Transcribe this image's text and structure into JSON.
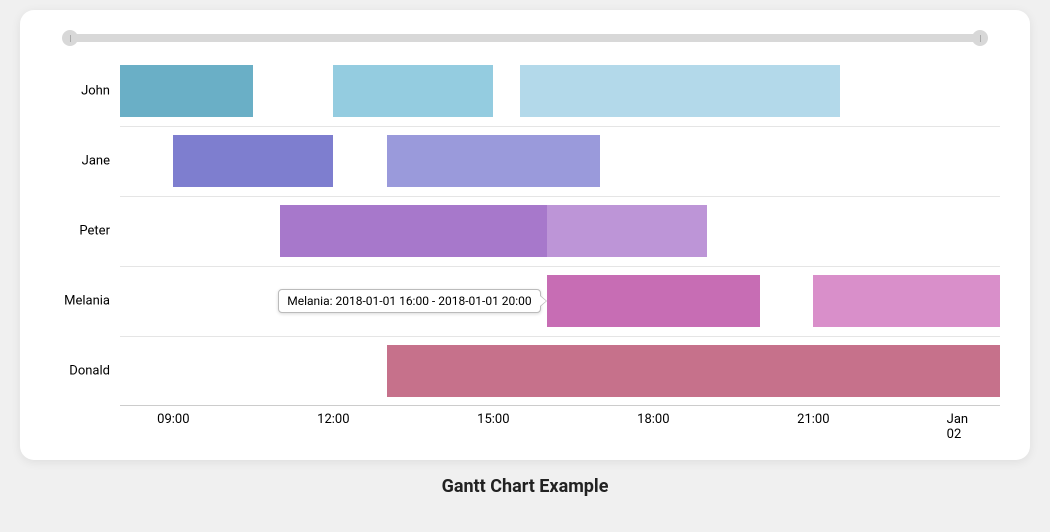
{
  "caption": "Gantt Chart Example",
  "chart_data": {
    "type": "bar",
    "orientation": "gantt",
    "x_axis": {
      "min": "2018-01-01 08:00",
      "max": "2018-01-02 00:30",
      "ticks": [
        "09:00",
        "12:00",
        "15:00",
        "18:00",
        "21:00",
        "Jan 02"
      ],
      "tick_values": [
        "2018-01-01 09:00",
        "2018-01-01 12:00",
        "2018-01-01 15:00",
        "2018-01-01 18:00",
        "2018-01-01 21:00",
        "2018-01-02 00:00"
      ]
    },
    "categories": [
      "John",
      "Jane",
      "Peter",
      "Melania",
      "Donald"
    ],
    "series": [
      {
        "category": "John",
        "start": "2018-01-01 08:00",
        "end": "2018-01-01 10:30",
        "color": "#6aafc6"
      },
      {
        "category": "John",
        "start": "2018-01-01 12:00",
        "end": "2018-01-01 15:00",
        "color": "#94cce0"
      },
      {
        "category": "John",
        "start": "2018-01-01 15:30",
        "end": "2018-01-01 21:30",
        "color": "#b3d9ea"
      },
      {
        "category": "Jane",
        "start": "2018-01-01 09:00",
        "end": "2018-01-01 12:00",
        "color": "#7e7ecf"
      },
      {
        "category": "Jane",
        "start": "2018-01-01 13:00",
        "end": "2018-01-01 17:00",
        "color": "#9a9adb"
      },
      {
        "category": "Peter",
        "start": "2018-01-01 11:00",
        "end": "2018-01-01 16:00",
        "color": "#a778cb"
      },
      {
        "category": "Peter",
        "start": "2018-01-01 16:00",
        "end": "2018-01-01 19:00",
        "color": "#bd95d7"
      },
      {
        "category": "Melania",
        "start": "2018-01-01 16:00",
        "end": "2018-01-01 20:00",
        "color": "#c76db4"
      },
      {
        "category": "Melania",
        "start": "2018-01-01 21:00",
        "end": "2018-01-02 00:30",
        "color": "#d98fca"
      },
      {
        "category": "Donald",
        "start": "2018-01-01 13:00",
        "end": "2018-01-02 00:30",
        "color": "#c6718b"
      }
    ],
    "tooltip": {
      "category": "Melania",
      "text": "Melania: 2018-01-01 16:00 - 2018-01-01 20:00",
      "attach_to_series_index": 7
    }
  }
}
